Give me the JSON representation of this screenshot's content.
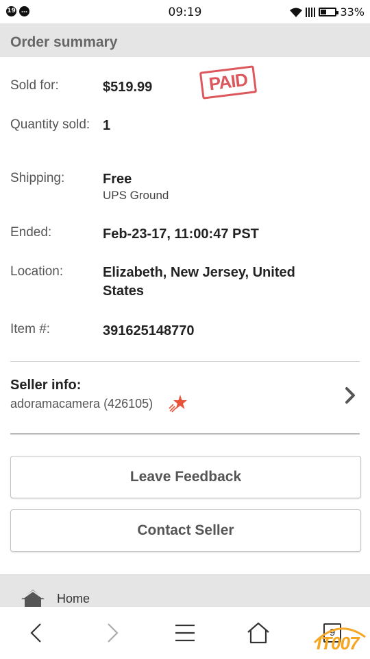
{
  "status_bar": {
    "time": "09:19",
    "battery": "33%",
    "notif_left": "19"
  },
  "header": {
    "title": "Order summary"
  },
  "order": {
    "sold_for_label": "Sold for:",
    "sold_for_value": "$519.99",
    "paid_stamp": "PAID",
    "quantity_label": "Quantity sold:",
    "quantity_value": "1",
    "shipping_label": "Shipping:",
    "shipping_value": "Free",
    "shipping_service": "UPS Ground",
    "ended_label": "Ended:",
    "ended_value": "Feb-23-17, 11:00:47 PST",
    "location_label": "Location:",
    "location_value": "Elizabeth, New Jersey, United States",
    "item_label": "Item #:",
    "item_value": "391625148770"
  },
  "seller": {
    "title": "Seller info:",
    "name": "adoramacamera (426105)",
    "star_color": "#e8533a"
  },
  "buttons": {
    "leave_feedback": "Leave Feedback",
    "contact_seller": "Contact Seller"
  },
  "footer_nav": {
    "home_label": "Home"
  },
  "system_nav": {
    "tabs_count": "9"
  },
  "watermark": {
    "text": "IT007"
  },
  "colors": {
    "header_bg": "#e5e5e5",
    "paid_red": "#d9464b",
    "watermark_orange": "#f5a623"
  }
}
